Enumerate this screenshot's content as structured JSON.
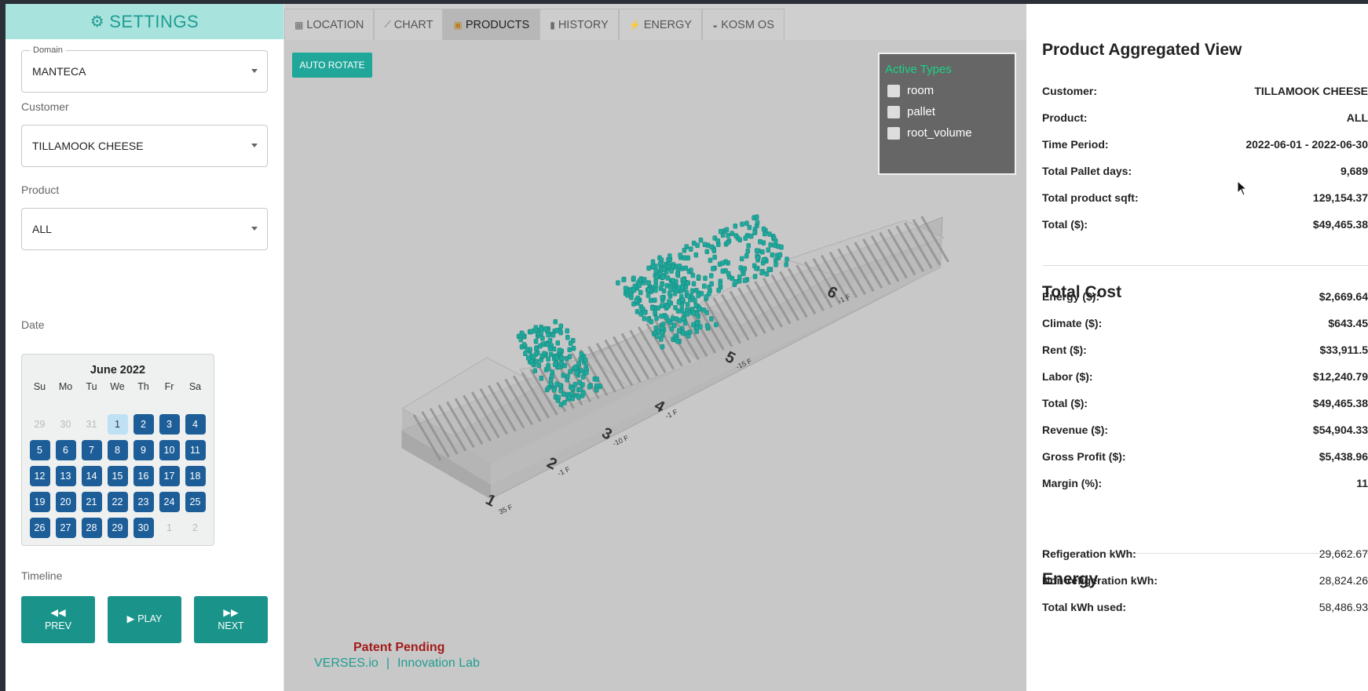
{
  "sidebar": {
    "header": "SETTINGS",
    "domain_label": "Domain",
    "domain_value": "MANTECA",
    "customer_label": "Customer",
    "customer_value": "TILLAMOOK CHEESE",
    "product_label": "Product",
    "product_value": "ALL",
    "date_label": "Date",
    "calendar": {
      "title": "June 2022",
      "dow": [
        "Su",
        "Mo",
        "Tu",
        "We",
        "Th",
        "Fr",
        "Sa"
      ],
      "days": [
        {
          "n": "29",
          "state": "muted"
        },
        {
          "n": "30",
          "state": "muted"
        },
        {
          "n": "31",
          "state": "muted"
        },
        {
          "n": "1",
          "state": "today"
        },
        {
          "n": "2",
          "state": "active"
        },
        {
          "n": "3",
          "state": "active"
        },
        {
          "n": "4",
          "state": "active"
        },
        {
          "n": "5",
          "state": "active"
        },
        {
          "n": "6",
          "state": "active"
        },
        {
          "n": "7",
          "state": "active"
        },
        {
          "n": "8",
          "state": "active"
        },
        {
          "n": "9",
          "state": "active"
        },
        {
          "n": "10",
          "state": "active"
        },
        {
          "n": "11",
          "state": "active"
        },
        {
          "n": "12",
          "state": "active"
        },
        {
          "n": "13",
          "state": "active"
        },
        {
          "n": "14",
          "state": "active"
        },
        {
          "n": "15",
          "state": "active"
        },
        {
          "n": "16",
          "state": "active"
        },
        {
          "n": "17",
          "state": "active"
        },
        {
          "n": "18",
          "state": "active"
        },
        {
          "n": "19",
          "state": "active"
        },
        {
          "n": "20",
          "state": "active"
        },
        {
          "n": "21",
          "state": "active"
        },
        {
          "n": "22",
          "state": "active"
        },
        {
          "n": "23",
          "state": "active"
        },
        {
          "n": "24",
          "state": "active"
        },
        {
          "n": "25",
          "state": "active"
        },
        {
          "n": "26",
          "state": "active"
        },
        {
          "n": "27",
          "state": "active"
        },
        {
          "n": "28",
          "state": "active"
        },
        {
          "n": "29",
          "state": "active"
        },
        {
          "n": "30",
          "state": "active"
        },
        {
          "n": "1",
          "state": "muted"
        },
        {
          "n": "2",
          "state": "muted"
        }
      ]
    },
    "timeline_label": "Timeline",
    "prev_label": "PREV",
    "play_label": "PLAY",
    "next_label": "NEXT"
  },
  "tabs": [
    {
      "label": "LOCATION",
      "icon": "grid-icon"
    },
    {
      "label": "CHART",
      "icon": "line-chart-icon"
    },
    {
      "label": "PRODUCTS",
      "icon": "box-icon"
    },
    {
      "label": "HISTORY",
      "icon": "history-icon"
    },
    {
      "label": "ENERGY",
      "icon": "bolt-icon"
    },
    {
      "label": "KOSM OS",
      "icon": "os-icon"
    }
  ],
  "active_tab": "PRODUCTS",
  "viewer": {
    "auto_rotate_label": "AUTO ROTATE",
    "active_types_title": "Active Types",
    "active_types": [
      "room",
      "pallet",
      "root_volume"
    ],
    "rooms": [
      {
        "num": "1",
        "temp": "35 F"
      },
      {
        "num": "2",
        "temp": "-1 F"
      },
      {
        "num": "3",
        "temp": "-10 F"
      },
      {
        "num": "4",
        "temp": "-1 F"
      },
      {
        "num": "5",
        "temp": "-15 F"
      },
      {
        "num": "6",
        "temp": "-1 F"
      }
    ],
    "patent": "Patent Pending",
    "brand": "VERSES.io",
    "brand_sep": "|",
    "lab": "Innovation Lab"
  },
  "panel": {
    "title": "Product Aggregated View",
    "summary": [
      {
        "k": "Customer:",
        "v": "TILLAMOOK CHEESE"
      },
      {
        "k": "Product:",
        "v": "ALL"
      },
      {
        "k": "Time Period:",
        "v": "2022-06-01 - 2022-06-30"
      },
      {
        "k": "Total Pallet days:",
        "v": "9,689"
      },
      {
        "k": "Total product sqft:",
        "v": "129,154.37"
      },
      {
        "k": "Total ($):",
        "v": "$49,465.38"
      }
    ],
    "cost_title": "Total Cost",
    "cost": [
      {
        "k": "Energy ($):",
        "v": "$2,669.64"
      },
      {
        "k": "Climate ($):",
        "v": "$643.45"
      },
      {
        "k": "Rent ($):",
        "v": "$33,911.5"
      },
      {
        "k": "Labor ($):",
        "v": "$12,240.79"
      },
      {
        "k": "Total ($):",
        "v": "$49,465.38"
      },
      {
        "k": "Revenue ($):",
        "v": "$54,904.33"
      },
      {
        "k": "Gross Profit ($):",
        "v": "$5,438.96"
      },
      {
        "k": "Margin (%):",
        "v": "11"
      }
    ],
    "energy_title": "Energy",
    "energy": [
      {
        "k": "Refigeration kWh:",
        "v": "29,662.67"
      },
      {
        "k": "Non-refigeration kWh:",
        "v": "28,824.26"
      },
      {
        "k": "Total kWh used:",
        "v": "58,486.93"
      }
    ]
  },
  "colors": {
    "accent": "#1a948a",
    "header_bg": "#a9e3dd",
    "calendar_day": "#1d5e99",
    "pallet": "#1fa89c",
    "viewport_bg": "#c8c8c8"
  }
}
